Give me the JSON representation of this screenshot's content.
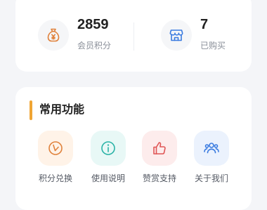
{
  "stats": {
    "points": {
      "value": "2859",
      "label": "会员积分",
      "icon": "money-bag-icon"
    },
    "bought": {
      "value": "7",
      "label": "已购买",
      "icon": "store-icon"
    }
  },
  "functions": {
    "title": "常用功能",
    "accent_color": "#f0a534",
    "items": [
      {
        "label": "积分兑换",
        "icon": "exchange-icon",
        "color": "#e0823c",
        "bg": "#fff3e8"
      },
      {
        "label": "使用说明",
        "icon": "info-icon",
        "color": "#2bb3a7",
        "bg": "#e8f8f6"
      },
      {
        "label": "赞赏支持",
        "icon": "thumbs-up-icon",
        "color": "#e05555",
        "bg": "#fdecec"
      },
      {
        "label": "关于我们",
        "icon": "team-icon",
        "color": "#3a7be0",
        "bg": "#ebf2fd"
      }
    ]
  }
}
